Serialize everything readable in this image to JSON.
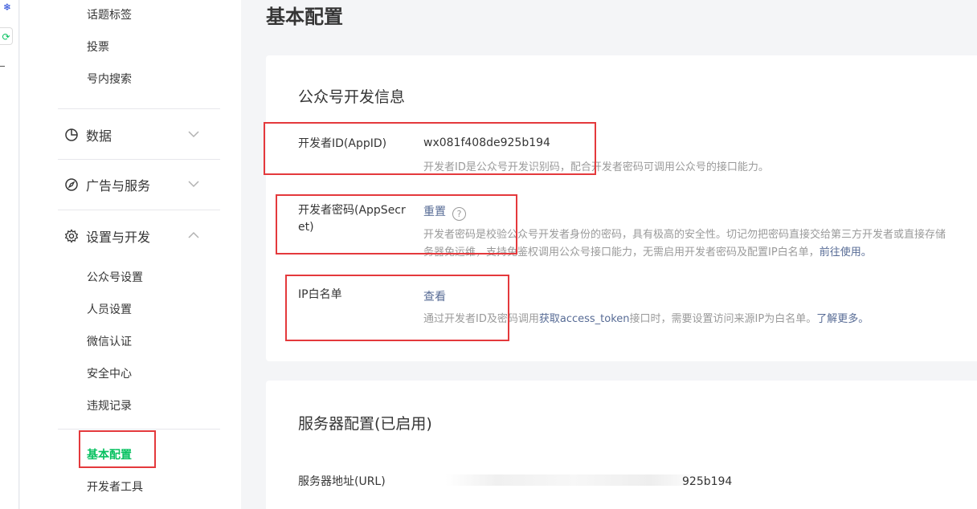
{
  "sidebar": {
    "top_items": [
      "话题标签",
      "投票",
      "号内搜索"
    ],
    "groups": [
      {
        "label": "数据",
        "icon": "pie-chart-icon"
      },
      {
        "label": "广告与服务",
        "icon": "compass-icon"
      },
      {
        "label": "设置与开发",
        "icon": "gear-icon"
      }
    ],
    "settings_items": [
      "公众号设置",
      "人员设置",
      "微信认证",
      "安全中心",
      "违规记录"
    ],
    "dev_items": [
      "基本配置",
      "开发者工具"
    ]
  },
  "page": {
    "title": "基本配置"
  },
  "dev_info": {
    "title": "公众号开发信息",
    "appid_label": "开发者ID(AppID)",
    "appid_value": "wx081f408de925b194",
    "appid_desc": "开发者ID是公众号开发识别码，配合开发者密码可调用公众号的接口能力。",
    "secret_label": "开发者密码(AppSecret)",
    "secret_action": "重置",
    "secret_help": "?",
    "secret_desc_line1": "开发者密码是校验公众号开发者身份的密码，具有极高的安全性。切记勿把密码直接交给第三方开发者或直接存储",
    "secret_desc_line2": "务器免运维，支持免鉴权调用公众号接口能力，无需启用开发者密码及配置IP白名单，",
    "secret_desc_link": "前往使用。",
    "ip_label": "IP白名单",
    "ip_action": "查看",
    "ip_desc_pre": "通过开发者ID及密码调用",
    "ip_desc_link1": "获取access_token",
    "ip_desc_mid": "接口时，需要设置访问来源IP为白名单。",
    "ip_desc_link2": "了解更多。"
  },
  "server": {
    "title": "服务器配置(已启用)",
    "url_label": "服务器地址(URL)",
    "url_value_visible": "925b194"
  },
  "colors": {
    "accent_green": "#07c160",
    "link_blue": "#576b95",
    "highlight_red": "#e4393c"
  }
}
